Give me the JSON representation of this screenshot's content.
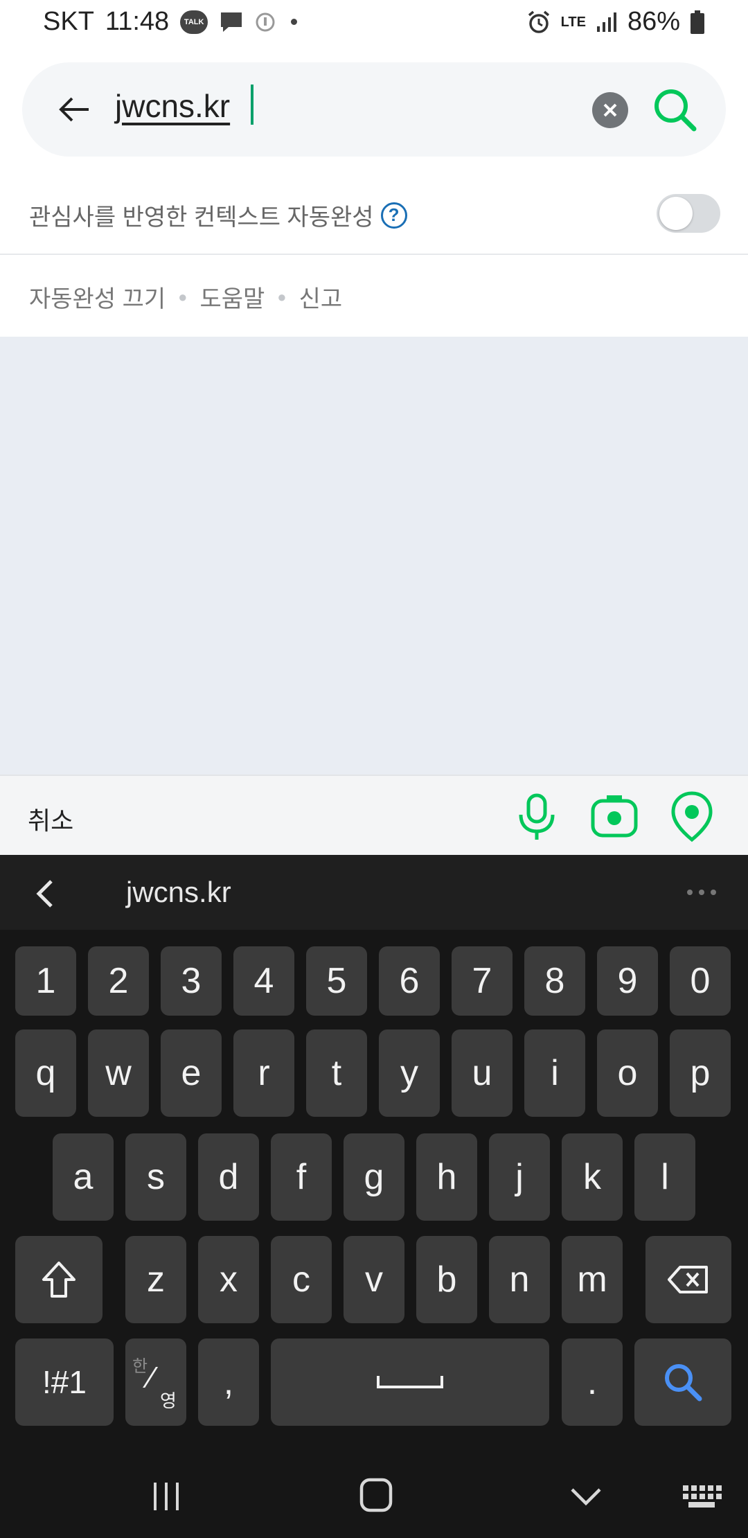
{
  "status_bar": {
    "carrier": "SKT",
    "time": "11:48",
    "talk_badge": "TALK",
    "network": "LTE",
    "battery": "86%"
  },
  "search": {
    "query": "jwcns.kr",
    "icons": {
      "back": "back-arrow-icon",
      "clear": "clear-icon",
      "search": "search-icon"
    }
  },
  "autocomplete": {
    "label": "관심사를 반영한 컨텍스트 자동완성",
    "help": "?",
    "enabled": false
  },
  "links": {
    "off": "자동완성 끄기",
    "help": "도움말",
    "report": "신고"
  },
  "action_bar": {
    "cancel": "취소",
    "icons": [
      "microphone-icon",
      "camera-lens-icon",
      "location-pin-icon"
    ],
    "accent": "#03c75a"
  },
  "keyboard": {
    "suggestion": "jwcns.kr",
    "numbers": [
      "1",
      "2",
      "3",
      "4",
      "5",
      "6",
      "7",
      "8",
      "9",
      "0"
    ],
    "row1": [
      "q",
      "w",
      "e",
      "r",
      "t",
      "y",
      "u",
      "i",
      "o",
      "p"
    ],
    "row2": [
      "a",
      "s",
      "d",
      "f",
      "g",
      "h",
      "j",
      "k",
      "l"
    ],
    "row3": [
      "z",
      "x",
      "c",
      "v",
      "b",
      "n",
      "m"
    ],
    "symbols_key": "!#1",
    "lang_top": "한",
    "lang_bottom": "영",
    "comma": ",",
    "period": ".",
    "search_accent": "#4a90f5"
  }
}
